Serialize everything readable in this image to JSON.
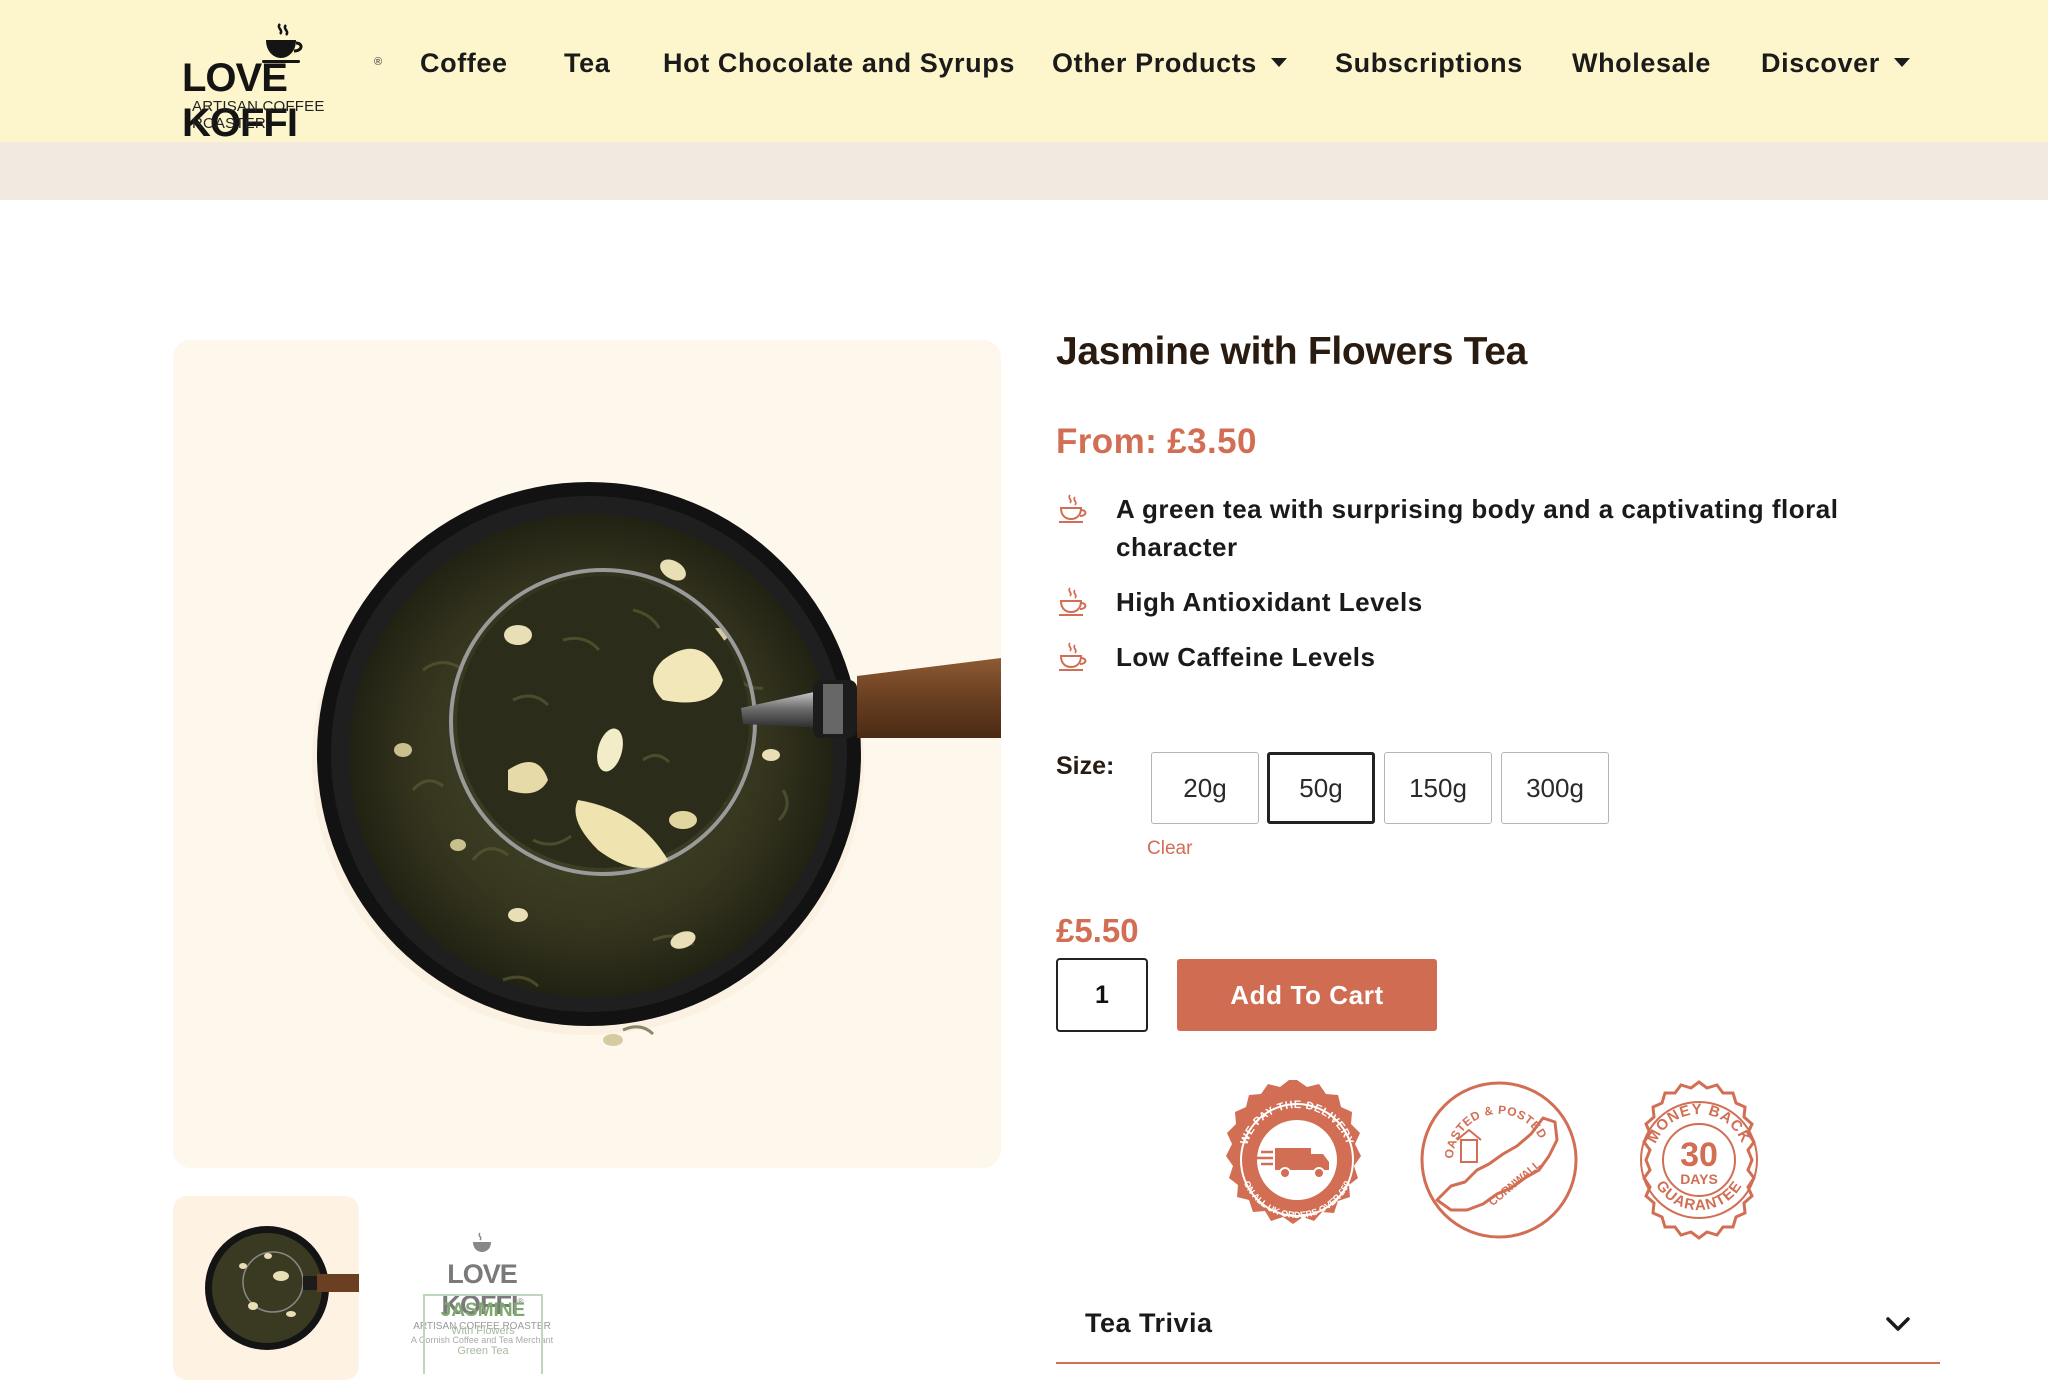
{
  "header": {
    "logo": {
      "brand": "LOVE KOFFI",
      "registered": "®",
      "tagline": "ARTISAN COFFEE ROASTER"
    },
    "nav": [
      {
        "label": "Coffee",
        "has_dropdown": false
      },
      {
        "label": "Tea",
        "has_dropdown": false
      },
      {
        "label": "Hot Chocolate and Syrups",
        "has_dropdown": false
      },
      {
        "label": "Other Products",
        "has_dropdown": true
      },
      {
        "label": "Subscriptions",
        "has_dropdown": false
      },
      {
        "label": "Wholesale",
        "has_dropdown": false
      },
      {
        "label": "Discover",
        "has_dropdown": true
      }
    ]
  },
  "gallery": {
    "main_image": "loose-leaf-jasmine-tea-in-bowl-with-scoop",
    "thumbnails": [
      {
        "image": "loose-leaf-jasmine-tea-in-bowl-with-scoop"
      },
      {
        "image": "jasmine-tea-package-label",
        "pack_brand": "LOVE KOFFI",
        "pack_registered": "®",
        "pack_tagline": "ARTISAN COFFEE ROASTER",
        "pack_subline": "A Cornish Coffee and Tea Merchant",
        "pack_name": "JASMINE",
        "pack_variant": "With Flowers",
        "pack_type": "Green Tea"
      }
    ]
  },
  "product": {
    "title": "Jasmine with Flowers Tea",
    "from_price": "From: £3.50",
    "features": [
      "A green tea with surprising body and a captivating floral character",
      "High Antioxidant Levels",
      "Low Caffeine Levels"
    ],
    "feature_icon": "teacup-icon",
    "size_label": "Size:",
    "sizes": [
      "20g",
      "50g",
      "150g",
      "300g"
    ],
    "selected_size": "50g",
    "clear_label": "Clear",
    "price": "£5.50",
    "quantity": "1",
    "add_to_cart": "Add To Cart"
  },
  "badges": [
    {
      "name": "free-delivery-badge",
      "top_text": "WE PAY THE DELIVERY",
      "bottom_text": "ON ALL UK ORDERS OVER £50",
      "icon": "truck-icon"
    },
    {
      "name": "cornwall-badge",
      "top_text": "ROASTED & POSTED",
      "center_text": "CORNWALL",
      "icon": "cornwall-map-icon"
    },
    {
      "name": "money-back-badge",
      "top_text": "MONEY BACK",
      "number": "30",
      "unit": "DAYS",
      "bottom_text": "GUARANTEE"
    }
  ],
  "accordion": {
    "label": "Tea Trivia",
    "icon": "chevron-down-icon"
  },
  "colors": {
    "header_bg": "#fdf6cc",
    "accent": "#d16e54",
    "subbar_bg": "#f2e9e0",
    "image_bg": "#fef7ec",
    "title": "#2a1b10"
  }
}
